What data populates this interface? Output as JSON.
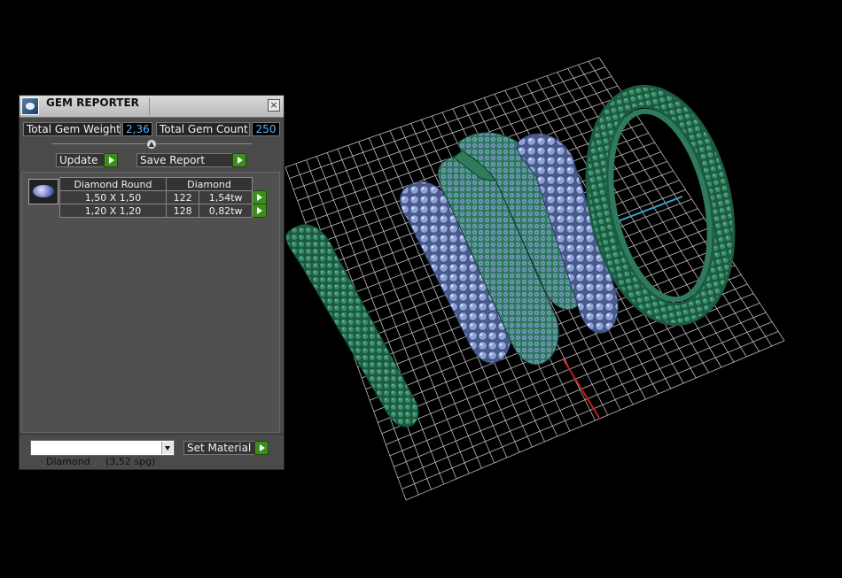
{
  "panel": {
    "title": "GEM REPORTER",
    "close_glyph": "×",
    "total_weight_label": "Total Gem Weight",
    "total_weight_value": "2,36",
    "total_count_label": "Total Gem Count",
    "total_count_value": "250",
    "update_label": "Update",
    "save_report_label": "Save Report",
    "table": {
      "headers": [
        "Diamond Round",
        "Diamond"
      ],
      "rows": [
        {
          "size": "1,50 X 1,50",
          "count": "122",
          "weight": "1,54tw"
        },
        {
          "size": "1,20 X 1,20",
          "count": "128",
          "weight": "0,82tw"
        }
      ]
    },
    "material_select_value": "Diamond     (3,52 spg)",
    "set_material_label": "Set Material"
  },
  "icons": {
    "app": "gem-reporter-icon",
    "close": "close-icon",
    "collapse": "collapse-handle-icon",
    "go": "play-arrow-icon",
    "dropdown": "chevron-down-icon"
  },
  "colors": {
    "value_text": "#5ab4ff",
    "go_button": "#3c8c1e",
    "ring_green": "#2f7b5c",
    "gem_blue": "#8b9fd6",
    "axis_red": "#c02020",
    "axis_blue": "#3aa0c8",
    "axis_yellow": "#d0a020"
  }
}
